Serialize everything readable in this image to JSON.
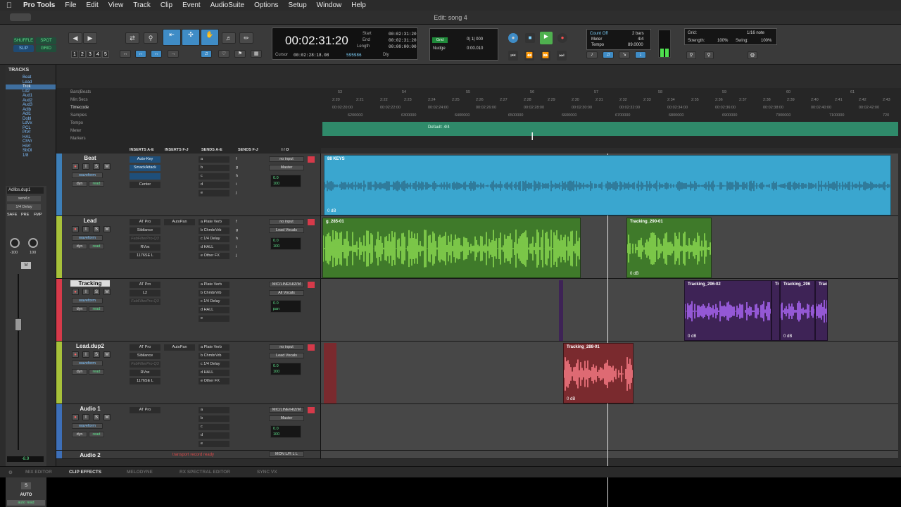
{
  "menubar": {
    "apple": "",
    "items": [
      "Pro Tools",
      "File",
      "Edit",
      "View",
      "Track",
      "Clip",
      "Event",
      "AudioSuite",
      "Options",
      "Setup",
      "Window",
      "Help"
    ]
  },
  "window": {
    "title": "Edit: song 4"
  },
  "toolbar": {
    "modes": [
      "SHUFFLE",
      "SPOT",
      "SLIP",
      "GRID"
    ],
    "zoom_presets": [
      "1",
      "2",
      "3",
      "4",
      "5"
    ],
    "main_counter": "00:02:31:20",
    "start_label": "Start",
    "start_value": "00:02:31:20",
    "end_label": "End",
    "end_value": "00:02:31:20",
    "length_label": "Length",
    "length_value": "00:00:00:00",
    "cursor_label": "Cursor",
    "cursor_value": "00:02:28:18.08",
    "samples_value": "595986",
    "dly_label": "Dly",
    "grid_label": "Grid",
    "grid_value": "0| 1| 000",
    "nudge_label": "Nudge",
    "nudge_value": "0:00.010",
    "countoff_label": "Count Off",
    "count_bars": "2 bars",
    "meter_label": "Meter",
    "meter_value": "4/4",
    "tempo_label": "Tempo",
    "tempo_value": "89.0000",
    "grid2_label": "Grid:",
    "grid2_value": "1/16 note",
    "strength_label": "Strength:",
    "strength_value": "100%",
    "swing_label": "Swing:",
    "swing_value": "100%"
  },
  "tracklist": {
    "header": "TRACKS",
    "items": [
      "Beat",
      "Lead",
      "Trck",
      "Ld2",
      "Aud1",
      "Aud2",
      "Aud3",
      "Adlb",
      "Adl1",
      "Dobl",
      "LdVx",
      "PCL",
      "PtVr",
      "HAL",
      "ChVr",
      "HiVr",
      "SbOl",
      "1/8"
    ],
    "selected_index": 2
  },
  "channel_strip": {
    "name": "Adlibs.dup1",
    "send": "send c",
    "insert": "1/4 Delay",
    "safe": "SAFE",
    "pre": "PRE",
    "fmp": "FMP",
    "pan_l": "-100",
    "pan_r": "100",
    "meter_m": "M",
    "fader_value": "-8.9",
    "track_label": "TRACK",
    "solo": "S",
    "auto_label": "AUTO",
    "auto_mode": "auto read"
  },
  "rulers": {
    "labels": [
      "Bars|Beats",
      "Min:Secs",
      "Timecode",
      "Samples",
      "Tempo",
      "Meter",
      "Markers"
    ],
    "bars": [
      "53",
      "54",
      "55",
      "56",
      "57",
      "58",
      "59",
      "60",
      "61"
    ],
    "minsecs": [
      "2:20",
      "2:21",
      "2:22",
      "2:23",
      "2:24",
      "2:25",
      "2:26",
      "2:27",
      "2:28",
      "2:29",
      "2:30",
      "2:31",
      "2:32",
      "2:33",
      "2:34",
      "2:35",
      "2:36",
      "2:37",
      "2:38",
      "2:39",
      "2:40",
      "2:41",
      "2:42",
      "2:43"
    ],
    "timecode": [
      "00:02:20:00",
      "00:02:22:00",
      "00:02:24:00",
      "00:02:26:00",
      "00:02:28:00",
      "00:02:30:00",
      "00:02:32:00",
      "00:02:34:00",
      "00:02:36:00",
      "00:02:38:00",
      "00:02:40:00",
      "00:02:42:00"
    ],
    "samples": [
      "6200000",
      "6300000",
      "6400000",
      "6500000",
      "6600000",
      "6700000",
      "6800000",
      "6900000",
      "7000000",
      "7100000",
      "720"
    ],
    "meter_text": "Default: 4/4"
  },
  "columns": [
    "INSERTS A-E",
    "INSERTS F-J",
    "SENDS A-E",
    "SENDS F-J",
    "I / O"
  ],
  "tracks": [
    {
      "name": "Beat",
      "color": "#3d7fb8",
      "view": "waveform",
      "dyn": "dyn",
      "read": "read",
      "inserts": [
        "Auto-Key",
        "SmackAttack",
        "",
        "Center"
      ],
      "sends": [
        "a",
        "b",
        "c",
        "d",
        "e"
      ],
      "sends2": [
        "f",
        "g",
        "h",
        "i",
        "j"
      ],
      "io_in": "no input",
      "io_out": "Master",
      "vol": "0.0",
      "pan_l": "100",
      "pan_r": "100"
    },
    {
      "name": "Lead",
      "color": "#a7c13a",
      "view": "waveform",
      "dyn": "dyn",
      "read": "read",
      "inserts": [
        "AT Pro",
        "Sibilance",
        "FabFilterPro-Q3",
        "RVox",
        "1176SE L"
      ],
      "inserts2": [
        "AutoPan"
      ],
      "sends": [
        "a Plate Verb",
        "b ChmbrVrb",
        "c 1/4 Delay",
        "d HALL",
        "e Other FX"
      ],
      "sends2": [
        "f",
        "g",
        "h",
        "i",
        "j"
      ],
      "io_in": "no input",
      "io_out": "Lead Vocals",
      "vol": "0.0",
      "pan_l": "100",
      "pan_r": "100"
    },
    {
      "name": "Tracking",
      "color": "#d63a4a",
      "view": "waveform",
      "dyn": "dyn",
      "read": "read",
      "inserts": [
        "AT Pro",
        "L2",
        "FabFilterPro-Q3"
      ],
      "sends": [
        "a Plate Verb",
        "b ChmbrVrb",
        "c 1/4 Delay",
        "d HALL",
        "e"
      ],
      "io_in": "MIC/LINE/HIZ/M",
      "io_out": "All Vocals",
      "vol": "0.0",
      "pan": "pan",
      "pan_val": "0"
    },
    {
      "name": "Lead.dup2",
      "color": "#a7c13a",
      "view": "waveform",
      "dyn": "dyn",
      "read": "read",
      "inserts": [
        "AT Pro",
        "Sibilance",
        "FabFilterPro-Q3",
        "RVox",
        "1176SE L"
      ],
      "inserts2": [
        "AutoPan"
      ],
      "sends": [
        "a Plate Verb",
        "b ChmbrVrb",
        "c 1/4 Delay",
        "d HALL",
        "e Other FX"
      ],
      "io_in": "no input",
      "io_out": "Lead Vocals",
      "vol": "0.0",
      "pan_l": "100",
      "pan_r": "100"
    },
    {
      "name": "Audio 1",
      "color": "#3d6fb8",
      "view": "waveform",
      "dyn": "dyn",
      "read": "read",
      "inserts": [
        "AT Pro"
      ],
      "sends": [
        "a",
        "b",
        "c",
        "d",
        "e"
      ],
      "io_in": "MIC/LINE/HIZ/M",
      "io_out": "Master",
      "vol": "0.0",
      "pan_l": "100",
      "pan_r": "100"
    },
    {
      "name": "Audio 2",
      "color": "#3d6fb8",
      "io_in": "MON L/R L L",
      "status": "transport record ready"
    }
  ],
  "clips": {
    "beat": {
      "name": "88 KEYS",
      "gain": "0 dB"
    },
    "lead1": {
      "name": "g_285-01",
      "gain": ""
    },
    "lead2": {
      "name": "Tracking_290-01",
      "gain": "0 dB"
    },
    "trk1": {
      "name": "Tracking_296-02",
      "gain": "0 dB"
    },
    "trk2": {
      "name": "Tr",
      "gain": ""
    },
    "trk3": {
      "name": "Tracking_296",
      "gain": "0 dB"
    },
    "trk4": {
      "name": "Trac",
      "gain": ""
    },
    "ld2": {
      "name": "Tracking_288-01",
      "gain": "0 dB"
    }
  },
  "bottom_tabs": [
    "MIX EDITOR",
    "CLIP EFFECTS",
    "MELODYNE",
    "RX SPECTRAL EDITOR",
    "SYNC VX"
  ],
  "colors": {
    "beat_clip": "#3aa6cf",
    "lead_clip": "#3f7a2a",
    "lead_wave": "#8fe052",
    "trk_clip": "#3e2356",
    "trk_wave": "#b06bff",
    "ld2_clip": "#7a2a2e",
    "ld2_wave": "#ff7f8a"
  }
}
